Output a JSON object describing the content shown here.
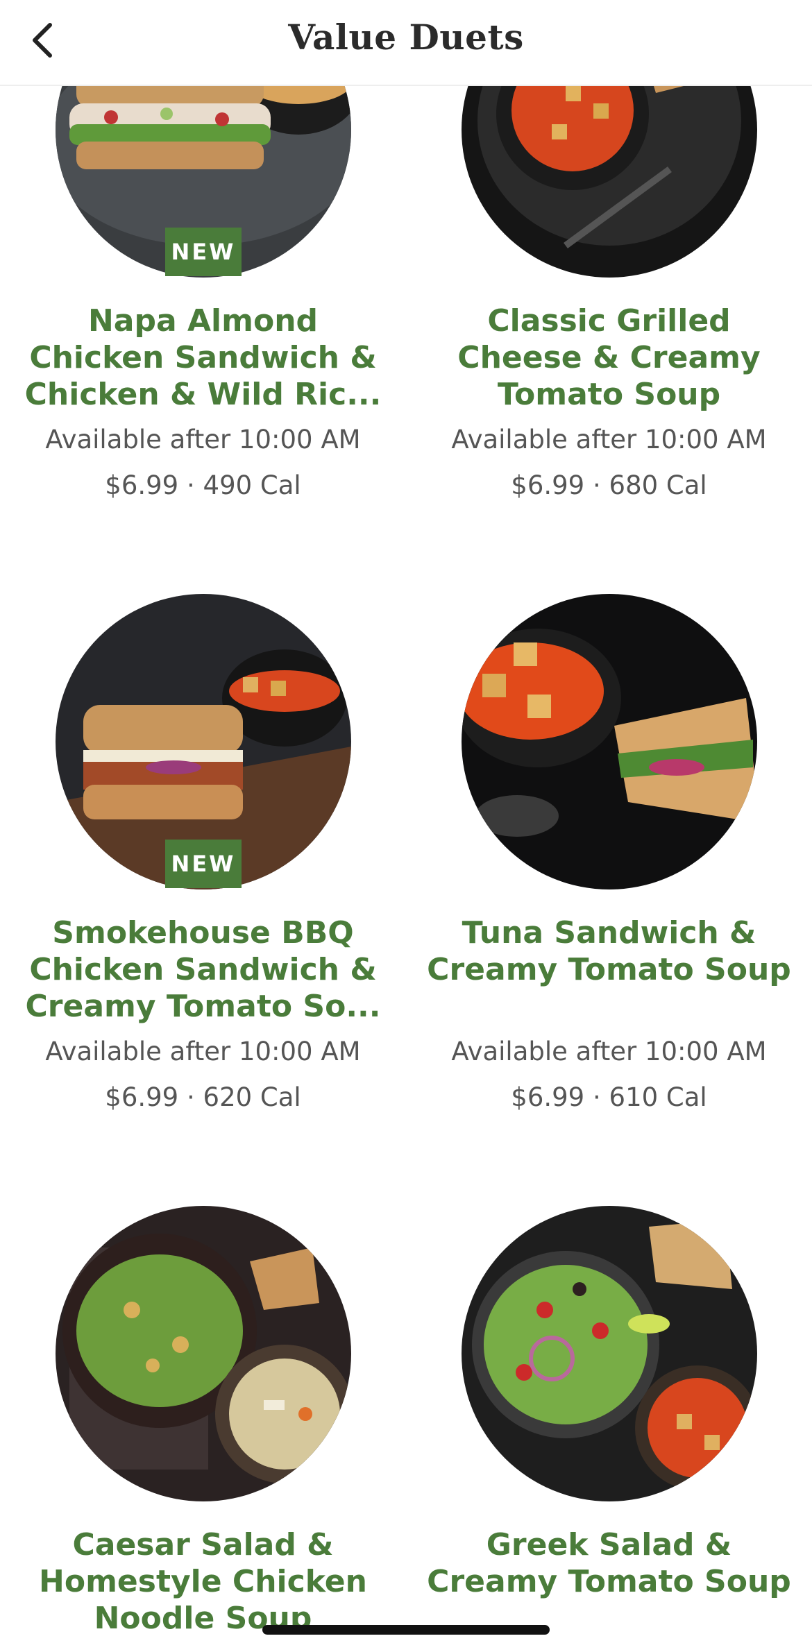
{
  "header": {
    "title": "Value Duets",
    "back_icon": "chevron-left-icon"
  },
  "items": [
    {
      "name": "Napa Almond Chicken Sandwich & Chicken & Wild Ric...",
      "availability": "Available after 10:00 AM",
      "price": "$6.99",
      "separator": "·",
      "calories": "490 Cal",
      "badge": "NEW"
    },
    {
      "name": "Classic Grilled Cheese & Creamy Tomato Soup",
      "availability": "Available after 10:00 AM",
      "price": "$6.99",
      "separator": "·",
      "calories": "680 Cal",
      "badge": ""
    },
    {
      "name": "Smokehouse BBQ Chicken Sandwich & Creamy Tomato So...",
      "availability": "Available after 10:00 AM",
      "price": "$6.99",
      "separator": "·",
      "calories": "620 Cal",
      "badge": "NEW"
    },
    {
      "name": "Tuna Sandwich & Creamy Tomato Soup",
      "availability": "Available after 10:00 AM",
      "price": "$6.99",
      "separator": "·",
      "calories": "610 Cal",
      "badge": ""
    },
    {
      "name": "Caesar Salad & Homestyle Chicken Noodle Soup",
      "availability": "",
      "price": "",
      "separator": "",
      "calories": "",
      "badge": ""
    },
    {
      "name": "Greek Salad & Creamy Tomato Soup",
      "availability": "",
      "price": "",
      "separator": "",
      "calories": "",
      "badge": ""
    }
  ],
  "colors": {
    "brand_green": "#4a7c3a",
    "text_gray": "#555555",
    "title_dark": "#2b2b2b"
  }
}
